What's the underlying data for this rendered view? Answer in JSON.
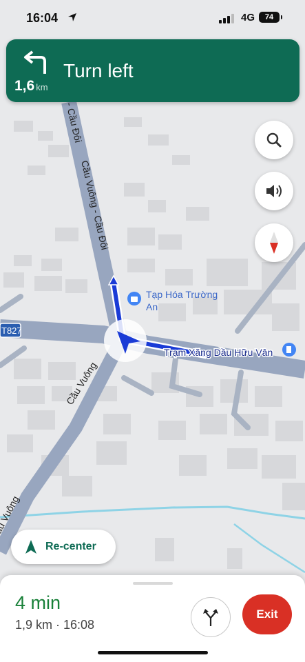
{
  "status_bar": {
    "time": "16:04",
    "network": "4G",
    "battery": "74"
  },
  "banner": {
    "instruction": "Turn left",
    "distance_value": "1,6",
    "distance_unit": "km"
  },
  "map": {
    "road_label_north_1": "- Cầu Đôi",
    "road_label_north_2": "Cầu Vuông - Cầu Đôi",
    "road_label_south_1": "Cầu Vuông",
    "road_label_south_2": "ầu Vuông",
    "route_badge": "T827",
    "poi_1_line1": "Tạp Hóa Trường",
    "poi_1_line2": "An",
    "poi_2": "Trạm Xăng Dầu Hữu Vân"
  },
  "controls": {
    "search_icon": "search-icon",
    "sound_icon": "volume-icon",
    "compass_icon": "compass-icon",
    "recenter_label": "Re-center"
  },
  "trip": {
    "eta_time": "4 min",
    "summary": "1,9 km · 16:08",
    "exit_label": "Exit"
  },
  "colors": {
    "banner": "#0e6b54",
    "route": "#1a3bd6",
    "exit": "#d93025",
    "eta": "#188038"
  }
}
